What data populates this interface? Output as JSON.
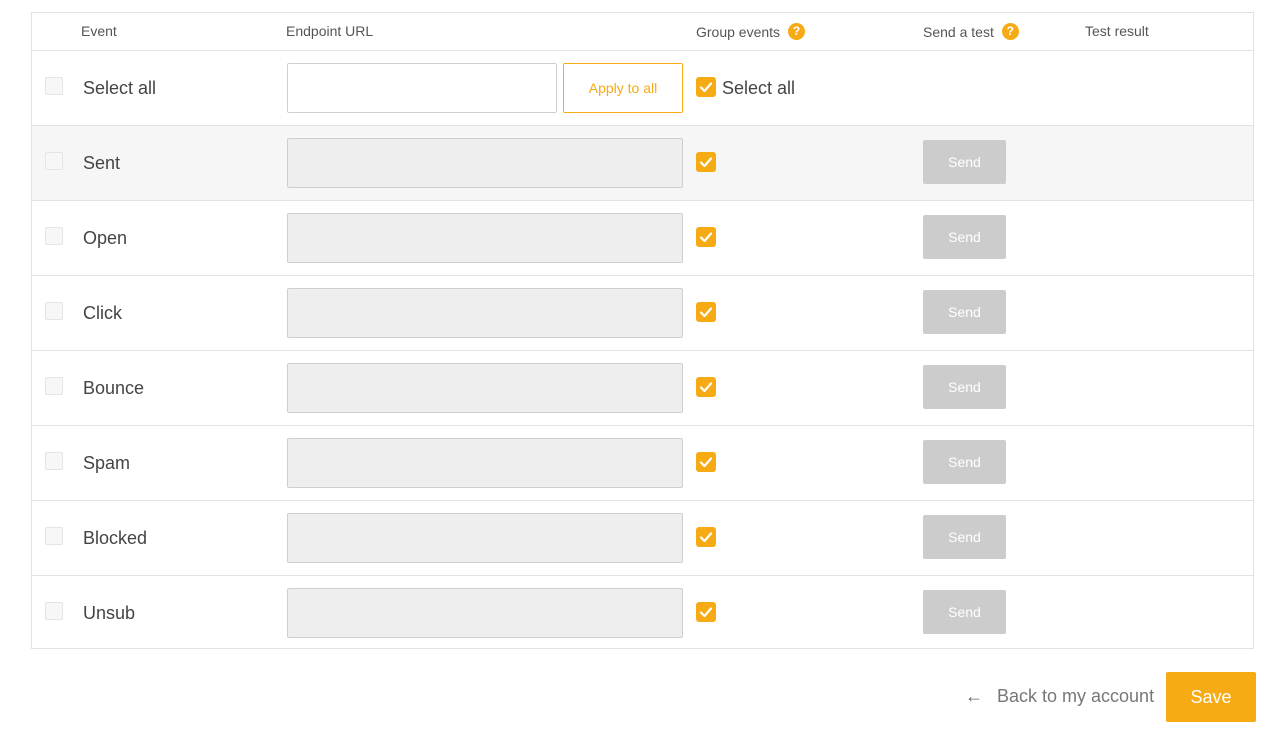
{
  "headers": {
    "event": "Event",
    "endpoint_url": "Endpoint URL",
    "group_events": "Group events",
    "send_test": "Send a test",
    "test_result": "Test result"
  },
  "help_glyph": "?",
  "select_all_row": {
    "label": "Select all",
    "url_value": "",
    "apply_label": "Apply to all",
    "group_label": "Select all",
    "group_checked": true
  },
  "events": [
    {
      "label": "Sent",
      "url_value": "",
      "group_checked": true,
      "send_label": "Send"
    },
    {
      "label": "Open",
      "url_value": "",
      "group_checked": true,
      "send_label": "Send"
    },
    {
      "label": "Click",
      "url_value": "",
      "group_checked": true,
      "send_label": "Send"
    },
    {
      "label": "Bounce",
      "url_value": "",
      "group_checked": true,
      "send_label": "Send"
    },
    {
      "label": "Spam",
      "url_value": "",
      "group_checked": true,
      "send_label": "Send"
    },
    {
      "label": "Blocked",
      "url_value": "",
      "group_checked": true,
      "send_label": "Send"
    },
    {
      "label": "Unsub",
      "url_value": "",
      "group_checked": true,
      "send_label": "Send"
    }
  ],
  "footer": {
    "back_label": "Back to my account",
    "save_label": "Save"
  },
  "colors": {
    "accent": "#f6ab15",
    "disabled_button": "#cccccc"
  }
}
